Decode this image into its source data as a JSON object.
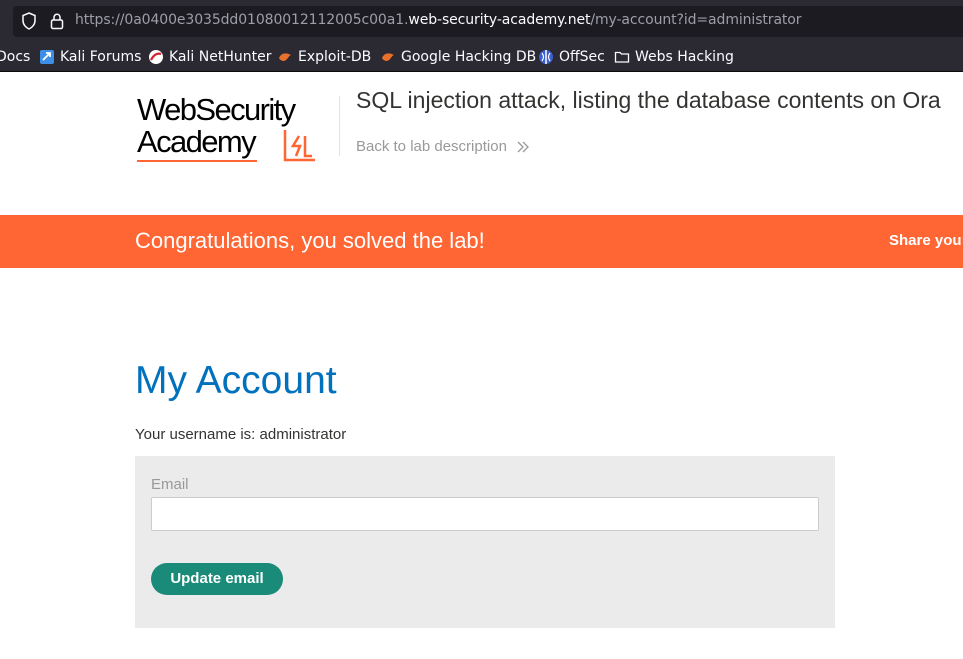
{
  "browser": {
    "url_prefix": "https://0a0400e3035dd01080012112005c00a1.",
    "url_host": "web-security-academy.net",
    "url_path": "/my-account?id=administrator",
    "bookmarks": [
      {
        "label": "Docs",
        "icon": "docs-icon"
      },
      {
        "label": "Kali Forums",
        "icon": "kali-forums-icon"
      },
      {
        "label": "Kali NetHunter",
        "icon": "kali-nethunter-icon"
      },
      {
        "label": "Exploit-DB",
        "icon": "exploit-db-icon"
      },
      {
        "label": "Google Hacking DB",
        "icon": "google-hacking-db-icon"
      },
      {
        "label": "OffSec",
        "icon": "offsec-icon"
      },
      {
        "label": "Webs Hacking",
        "icon": "folder-icon"
      }
    ]
  },
  "header": {
    "logo_line1": "WebSecurity",
    "logo_line2": "Academy",
    "lab_title": "SQL injection attack, listing the database contents on Ora",
    "back_link": "Back to lab description"
  },
  "banner": {
    "message": "Congratulations, you solved the lab!",
    "share": "Share you",
    "color": "#ff6633"
  },
  "account": {
    "heading": "My Account",
    "username_text": "Your username is: administrator",
    "email_label": "Email",
    "email_value": "",
    "update_button": "Update email"
  },
  "colors": {
    "accent": "#0071bc",
    "button": "#1a8b78"
  }
}
